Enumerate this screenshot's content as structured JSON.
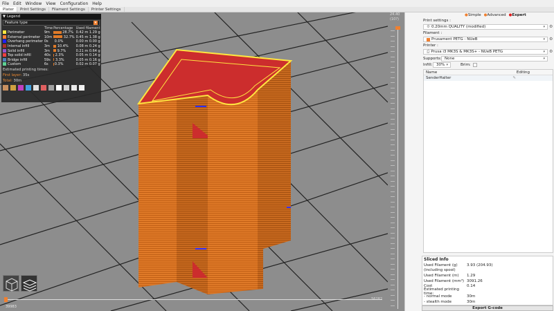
{
  "menu": [
    "File",
    "Edit",
    "Window",
    "View",
    "Configuration",
    "Help"
  ],
  "tabs": [
    "Plater",
    "Print Settings",
    "Filament Settings",
    "Printer Settings"
  ],
  "legend": {
    "title": "Legend",
    "feature_type": "Feature type",
    "col_time": "Time",
    "col_percentage": "Percentage",
    "col_filament": "Used filament",
    "rows": [
      {
        "name": "Perimeter",
        "color": "#ffe640",
        "time": "9m",
        "pct": "28.7%",
        "pct_value": 28.7,
        "fil": "0.42 m  1.29 g"
      },
      {
        "name": "External perimeter",
        "color": "#ff7d38",
        "time": "10m",
        "pct": "32.7%",
        "pct_value": 32.7,
        "fil": "0.45 m  1.38 g"
      },
      {
        "name": "Overhang perimeter",
        "color": "#1f1fff",
        "time": "0s",
        "pct": "0.0%",
        "pct_value": 0.0,
        "fil": "0.00 m  0.00 g"
      },
      {
        "name": "Internal infill",
        "color": "#b03029",
        "time": "3m",
        "pct": "10.4%",
        "pct_value": 10.4,
        "fil": "0.08 m  0.24 g"
      },
      {
        "name": "Solid infill",
        "color": "#9654cc",
        "time": "3m",
        "pct": "9.7%",
        "pct_value": 9.7,
        "fil": "0.21 m  0.64 g"
      },
      {
        "name": "Top solid infill",
        "color": "#f04040",
        "time": "40s",
        "pct": "2.3%",
        "pct_value": 2.3,
        "fil": "0.05 m  0.14 g"
      },
      {
        "name": "Bridge infill",
        "color": "#4d80ba",
        "time": "59s",
        "pct": "3.3%",
        "pct_value": 3.3,
        "fil": "0.05 m  0.16 g"
      },
      {
        "name": "Custom",
        "color": "#5ed194",
        "time": "6s",
        "pct": "0.3%",
        "pct_value": 0.3,
        "fil": "0.02 m  0.07 g"
      }
    ],
    "estimated": "Estimated printing times:",
    "first_layer_label": "First layer:",
    "first_layer_value": "35s",
    "total_label": "Total:",
    "total_value": "30m"
  },
  "hslider": {
    "left": "39983",
    "right": "56282"
  },
  "vslider": {
    "top_height": "24.40",
    "top_layer": "(10?)"
  },
  "panel": {
    "mode_simple": "Simple",
    "mode_advanced": "Advanced",
    "mode_expert": "Expert",
    "print_settings_label": "Print settings :",
    "print_settings_value": "0.20mm QUALITY (modified)",
    "filament_label": "Filament :",
    "filament_value": "Prusament PETG - NUeB",
    "printer_label": "Printer :",
    "printer_value": "Prusa i3 MK3S & MK3S+ - NUeB PETG",
    "supports_label": "Supports:",
    "supports_value": "None",
    "infill_label": "Infill:",
    "infill_value": "30%",
    "brim_label": "Brim:",
    "col_name": "Name",
    "col_editing": "Editing",
    "object_name": "SenderHalter"
  },
  "sliced": {
    "title": "Sliced Info",
    "rows": [
      {
        "k": "Used Filament (g)",
        "v": "3.93 (204.93)"
      },
      {
        "k": "(including spool)",
        "v": ""
      },
      {
        "k": "Used Filament (m)",
        "v": "1.29"
      },
      {
        "k": "Used Filament (mm³)",
        "v": "3091.26"
      },
      {
        "k": "Cost",
        "v": "0.14"
      },
      {
        "k": "Estimated printing time:",
        "v": ""
      },
      {
        "k": " - normal mode",
        "v": "30m"
      },
      {
        "k": " - stealth mode",
        "v": "30m"
      }
    ],
    "export_label": "Export G-code"
  },
  "colors": {
    "accent": "#f08030",
    "model": "#e07a28",
    "bed": "#8d8d8d"
  }
}
